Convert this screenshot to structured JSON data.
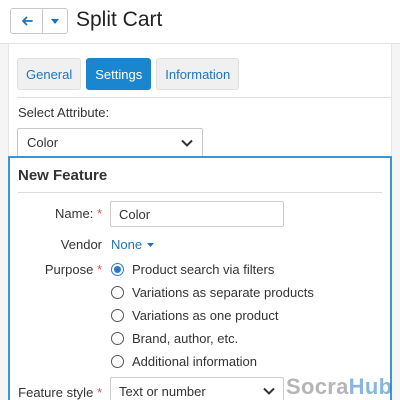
{
  "header": {
    "title": "Split Cart",
    "back_icon": "arrow-left-icon",
    "dropdown_icon": "caret-down-icon"
  },
  "tabs": [
    {
      "label": "General",
      "active": false
    },
    {
      "label": "Settings",
      "active": true
    },
    {
      "label": "Information",
      "active": false
    }
  ],
  "select_attribute": {
    "label": "Select Attribute:",
    "value": "Color"
  },
  "new_feature": {
    "title": "New Feature",
    "name": {
      "label": "Name:",
      "required": "*",
      "value": "Color"
    },
    "vendor": {
      "label": "Vendor",
      "value": "None"
    },
    "purpose": {
      "label": "Purpose",
      "required": "*",
      "options": [
        {
          "label": "Product search via filters",
          "checked": true
        },
        {
          "label": "Variations as separate products",
          "checked": false
        },
        {
          "label": "Variations as one product",
          "checked": false
        },
        {
          "label": "Brand, author, etc.",
          "checked": false
        },
        {
          "label": "Additional information",
          "checked": false
        }
      ]
    },
    "feature_style": {
      "label": "Feature style",
      "required": "*",
      "value": "Text or number"
    }
  },
  "watermark": {
    "part1": "Socra",
    "part2": "Hub"
  },
  "colors": {
    "accent": "#1a86d0",
    "link": "#1f74b7",
    "panel_border": "#3b95d8",
    "required": "#d9534f"
  }
}
